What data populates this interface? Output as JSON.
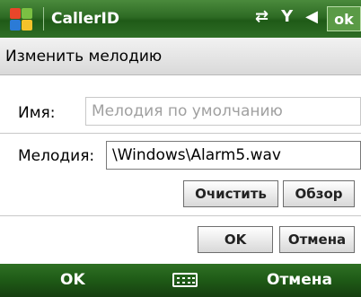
{
  "titlebar": {
    "app_title": "CallerID",
    "ok_label": "ok",
    "colors": {
      "bar": "#2e6b24",
      "text": "#ffffff"
    }
  },
  "header": {
    "title": "Изменить мелодию"
  },
  "form": {
    "name_label": "Имя:",
    "name_placeholder": "Мелодия по умолчанию",
    "ringtone_label": "Мелодия:",
    "ringtone_value": "\\Windows\\Alarm5.wav"
  },
  "buttons": {
    "clear": "Очистить",
    "browse": "Обзор",
    "ok": "OK",
    "cancel": "Отмена"
  },
  "menubar": {
    "left_softkey": "OK",
    "right_softkey": "Отмена"
  },
  "icons": [
    "windows-start-icon",
    "sync-icon",
    "signal-off-icon",
    "speaker-off-icon",
    "keyboard-icon"
  ]
}
